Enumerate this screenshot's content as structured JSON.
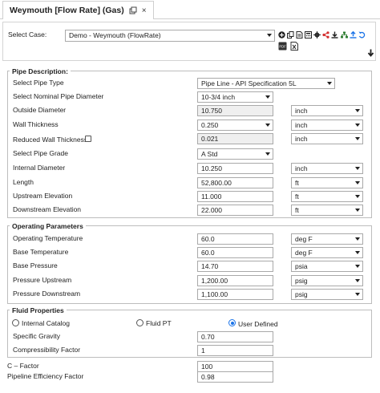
{
  "tab": {
    "title": "Weymouth [Flow Rate] (Gas)",
    "close": "×"
  },
  "case": {
    "label": "Select Case:",
    "value": "Demo - Weymouth (FlowRate)"
  },
  "toolbar": {
    "icons": [
      "add-icon",
      "copy-icon",
      "document-icon",
      "calculator-icon",
      "settings-icon",
      "share-icon",
      "download-icon",
      "network-icon",
      "upload-icon",
      "undo-icon",
      "pdf-icon",
      "excel-icon"
    ],
    "accent": "#1a73e8"
  },
  "pipe": {
    "title": "Pipe Description:",
    "pipe_type_label": "Select Pipe Type",
    "pipe_type_value": "Pipe Line - API Specification 5L",
    "nominal_label": "Select Nominal Pipe Diameter",
    "nominal_value": "10-3/4 inch",
    "od_label": "Outside Diameter",
    "od_value": "10.750",
    "od_unit": "inch",
    "wall_label": "Wall Thickness",
    "wall_value": "0.250",
    "wall_unit": "inch",
    "reduced_label": "Reduced Wall Thickness",
    "reduced_value": "0.021",
    "reduced_unit": "inch",
    "grade_label": "Select Pipe Grade",
    "grade_value": "A Std",
    "id_label": "Internal Diameter",
    "id_value": "10.250",
    "id_unit": "inch",
    "length_label": "Length",
    "length_value": "52,800.00",
    "length_unit": "ft",
    "up_elev_label": "Upstream Elevation",
    "up_elev_value": "11.000",
    "up_elev_unit": "ft",
    "down_elev_label": "Downstream Elevation",
    "down_elev_value": "22.000",
    "down_elev_unit": "ft"
  },
  "operating": {
    "title": "Operating Parameters",
    "op_temp_label": "Operating Temperature",
    "op_temp_value": "60.0",
    "op_temp_unit": "deg F",
    "base_temp_label": "Base Temperature",
    "base_temp_value": "60.0",
    "base_temp_unit": "deg F",
    "base_press_label": "Base Pressure",
    "base_press_value": "14.70",
    "base_press_unit": "psia",
    "p_up_label": "Pressure Upstream",
    "p_up_value": "1,200.00",
    "p_up_unit": "psig",
    "p_down_label": "Pressure Downstream",
    "p_down_value": "1,100.00",
    "p_down_unit": "psig"
  },
  "fluid": {
    "title": "Fluid Properties",
    "opt_catalog": "Internal Catalog",
    "opt_fluidpt": "Fluid PT",
    "opt_user": "User Defined",
    "selected": "User Defined",
    "sg_label": "Specific Gravity",
    "sg_value": "0.70",
    "comp_label": "Compressibility Factor",
    "comp_value": "1"
  },
  "footer": {
    "c_label": "C – Factor",
    "c_value": "100",
    "eff_label": "Pipeline Efficiency Factor",
    "eff_value": "0.98"
  }
}
